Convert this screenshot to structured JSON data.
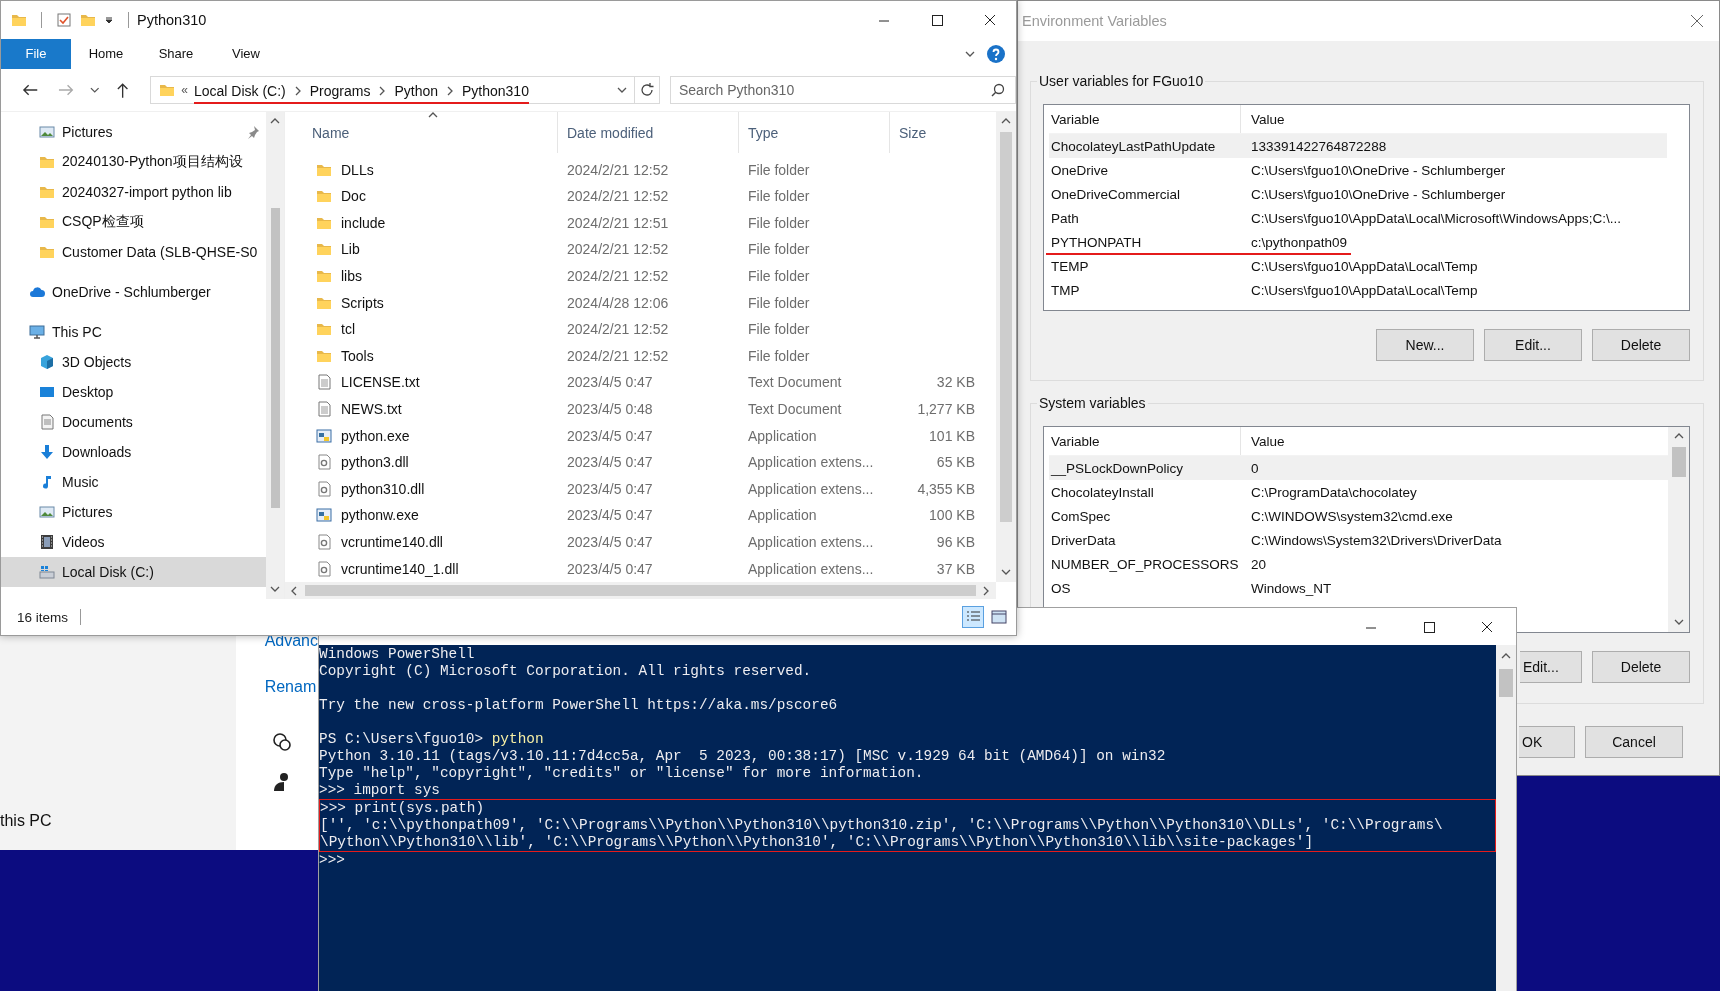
{
  "background_window": {
    "links": [
      "Advanc",
      "Renam"
    ],
    "label": "this PC"
  },
  "explorer": {
    "title": "Python310",
    "ribbon_tabs": [
      {
        "label": "File",
        "kind": "menu"
      },
      {
        "label": "Home",
        "kind": "tab"
      },
      {
        "label": "Share",
        "kind": "tab"
      },
      {
        "label": "View",
        "kind": "tab"
      }
    ],
    "address": {
      "overflow_marker": "«",
      "breadcrumbs": [
        "Local Disk (C:)",
        "Programs",
        "Python",
        "Python310"
      ],
      "underlined": true
    },
    "search": {
      "placeholder": "Search Python310"
    },
    "nav": {
      "quick_access": [
        {
          "label": "Pictures",
          "kind": "pictures",
          "pinned": true,
          "selected": false
        },
        {
          "label": "20240130-Python项目结构设",
          "kind": "folder",
          "pinned": false,
          "selected": false
        },
        {
          "label": "20240327-import python lib",
          "kind": "folder",
          "pinned": false,
          "selected": false
        },
        {
          "label": "CSQP检查项",
          "kind": "folder",
          "pinned": false,
          "selected": false
        },
        {
          "label": "Customer Data (SLB-QHSE-S0",
          "kind": "folder",
          "pinned": false,
          "selected": false
        }
      ],
      "roots": [
        {
          "label": "OneDrive - Schlumberger",
          "kind": "cloud",
          "selected": false
        },
        {
          "label": "This PC",
          "kind": "pc",
          "selected": false,
          "children": [
            {
              "label": "3D Objects",
              "kind": "cube",
              "selected": false
            },
            {
              "label": "Desktop",
              "kind": "desktop",
              "selected": false
            },
            {
              "label": "Documents",
              "kind": "documents",
              "selected": false
            },
            {
              "label": "Downloads",
              "kind": "downloads",
              "selected": false
            },
            {
              "label": "Music",
              "kind": "music",
              "selected": false
            },
            {
              "label": "Pictures",
              "kind": "pictures",
              "selected": false
            },
            {
              "label": "Videos",
              "kind": "videos",
              "selected": false
            },
            {
              "label": "Local Disk (C:)",
              "kind": "drive",
              "selected": true
            }
          ]
        }
      ]
    },
    "columns": [
      "Name",
      "Date modified",
      "Type",
      "Size"
    ],
    "files": [
      {
        "name": "DLLs",
        "date": "2024/2/21 12:52",
        "type": "File folder",
        "kind": "folder"
      },
      {
        "name": "Doc",
        "date": "2024/2/21 12:52",
        "type": "File folder",
        "kind": "folder"
      },
      {
        "name": "include",
        "date": "2024/2/21 12:51",
        "type": "File folder",
        "kind": "folder"
      },
      {
        "name": "Lib",
        "date": "2024/2/21 12:52",
        "type": "File folder",
        "kind": "folder"
      },
      {
        "name": "libs",
        "date": "2024/2/21 12:52",
        "type": "File folder",
        "kind": "folder"
      },
      {
        "name": "Scripts",
        "date": "2024/4/28 12:06",
        "type": "File folder",
        "kind": "folder"
      },
      {
        "name": "tcl",
        "date": "2024/2/21 12:52",
        "type": "File folder",
        "kind": "folder"
      },
      {
        "name": "Tools",
        "date": "2024/2/21 12:52",
        "type": "File folder",
        "kind": "folder"
      },
      {
        "name": "LICENSE.txt",
        "date": "2023/4/5 0:47",
        "type": "Text Document",
        "size": "32 KB",
        "kind": "text"
      },
      {
        "name": "NEWS.txt",
        "date": "2023/4/5 0:48",
        "type": "Text Document",
        "size": "1,277 KB",
        "kind": "text"
      },
      {
        "name": "python.exe",
        "date": "2023/4/5 0:47",
        "type": "Application",
        "size": "101 KB",
        "kind": "app"
      },
      {
        "name": "python3.dll",
        "date": "2023/4/5 0:47",
        "type": "Application extens...",
        "size": "65 KB",
        "kind": "dll"
      },
      {
        "name": "python310.dll",
        "date": "2023/4/5 0:47",
        "type": "Application extens...",
        "size": "4,355 KB",
        "kind": "dll"
      },
      {
        "name": "pythonw.exe",
        "date": "2023/4/5 0:47",
        "type": "Application",
        "size": "100 KB",
        "kind": "app"
      },
      {
        "name": "vcruntime140.dll",
        "date": "2023/4/5 0:47",
        "type": "Application extens...",
        "size": "96 KB",
        "kind": "dll"
      },
      {
        "name": "vcruntime140_1.dll",
        "date": "2023/4/5 0:47",
        "type": "Application extens...",
        "size": "37 KB",
        "kind": "dll"
      }
    ],
    "status": "16 items"
  },
  "env_dialog": {
    "title": "Environment Variables",
    "user_variables": {
      "title": "User variables for FGuo10",
      "columns": [
        "Variable",
        "Value"
      ],
      "rows": [
        {
          "variable": "ChocolateyLastPathUpdate",
          "value": "133391422764872288",
          "selected": true,
          "underlined": false
        },
        {
          "variable": "OneDrive",
          "value": "C:\\Users\\fguo10\\OneDrive - Schlumberger",
          "selected": false,
          "underlined": false
        },
        {
          "variable": "OneDriveCommercial",
          "value": "C:\\Users\\fguo10\\OneDrive - Schlumberger",
          "selected": false,
          "underlined": false
        },
        {
          "variable": "Path",
          "value": "C:\\Users\\fguo10\\AppData\\Local\\Microsoft\\WindowsApps;C:\\...",
          "selected": false,
          "underlined": false
        },
        {
          "variable": "PYTHONPATH",
          "value": "c:\\pythonpath09",
          "selected": false,
          "underlined": true
        },
        {
          "variable": "TEMP",
          "value": "C:\\Users\\fguo10\\AppData\\Local\\Temp",
          "selected": false,
          "underlined": false
        },
        {
          "variable": "TMP",
          "value": "C:\\Users\\fguo10\\AppData\\Local\\Temp",
          "selected": false,
          "underlined": false
        }
      ],
      "buttons": [
        "New...",
        "Edit...",
        "Delete"
      ]
    },
    "system_variables": {
      "title": "System variables",
      "columns": [
        "Variable",
        "Value"
      ],
      "rows": [
        {
          "variable": "__PSLockDownPolicy",
          "value": "0",
          "selected": true,
          "underlined": false
        },
        {
          "variable": "ChocolateyInstall",
          "value": "C:\\ProgramData\\chocolatey",
          "selected": false,
          "underlined": false
        },
        {
          "variable": "ComSpec",
          "value": "C:\\WINDOWS\\system32\\cmd.exe",
          "selected": false,
          "underlined": false
        },
        {
          "variable": "DriverData",
          "value": "C:\\Windows\\System32\\Drivers\\DriverData",
          "selected": false,
          "underlined": false
        },
        {
          "variable": "NUMBER_OF_PROCESSORS",
          "value": "20",
          "selected": false,
          "underlined": false
        },
        {
          "variable": "OS",
          "value": "Windows_NT",
          "selected": false,
          "underlined": false
        }
      ],
      "buttons": [
        "Edit...",
        "Delete"
      ]
    },
    "buttons": [
      "OK",
      "Cancel"
    ]
  },
  "powershell": {
    "lines": [
      {
        "kind": "text",
        "text": "Windows PowerShell",
        "highlighted": false
      },
      {
        "kind": "text",
        "text": "Copyright (C) Microsoft Corporation. All rights reserved.",
        "highlighted": false
      },
      {
        "kind": "blank",
        "highlighted": false
      },
      {
        "kind": "text",
        "text": "Try the new cross-platform PowerShell https://aka.ms/pscore6",
        "highlighted": false
      },
      {
        "kind": "blank",
        "highlighted": false
      },
      {
        "kind": "command",
        "prompt": "PS C:\\Users\\fguo10> ",
        "text": "python",
        "highlighted": false
      },
      {
        "kind": "text",
        "text": "Python 3.10.11 (tags/v3.10.11:7d4cc5a, Apr  5 2023, 00:38:17) [MSC v.1929 64 bit (AMD64)] on win32",
        "highlighted": false
      },
      {
        "kind": "text",
        "text": "Type \"help\", \"copyright\", \"credits\" or \"license\" for more information.",
        "highlighted": false
      },
      {
        "kind": "text",
        "text": ">>> import sys",
        "highlighted": false
      },
      {
        "kind": "text",
        "text": ">>> print(sys.path)",
        "highlighted": true
      },
      {
        "kind": "text",
        "text": "['', 'c:\\\\pythonpath09', 'C:\\\\Programs\\\\Python\\\\Python310\\\\python310.zip', 'C:\\\\Programs\\\\Python\\\\Python310\\\\DLLs', 'C:\\\\Programs\\",
        "highlighted": true
      },
      {
        "kind": "text",
        "text": "\\Python\\\\Python310\\\\lib', 'C:\\\\Programs\\\\Python\\\\Python310', 'C:\\\\Programs\\\\Python\\\\Python310\\\\lib\\\\site-packages']",
        "highlighted": true
      },
      {
        "kind": "text",
        "text": ">>>",
        "highlighted": false
      }
    ]
  }
}
